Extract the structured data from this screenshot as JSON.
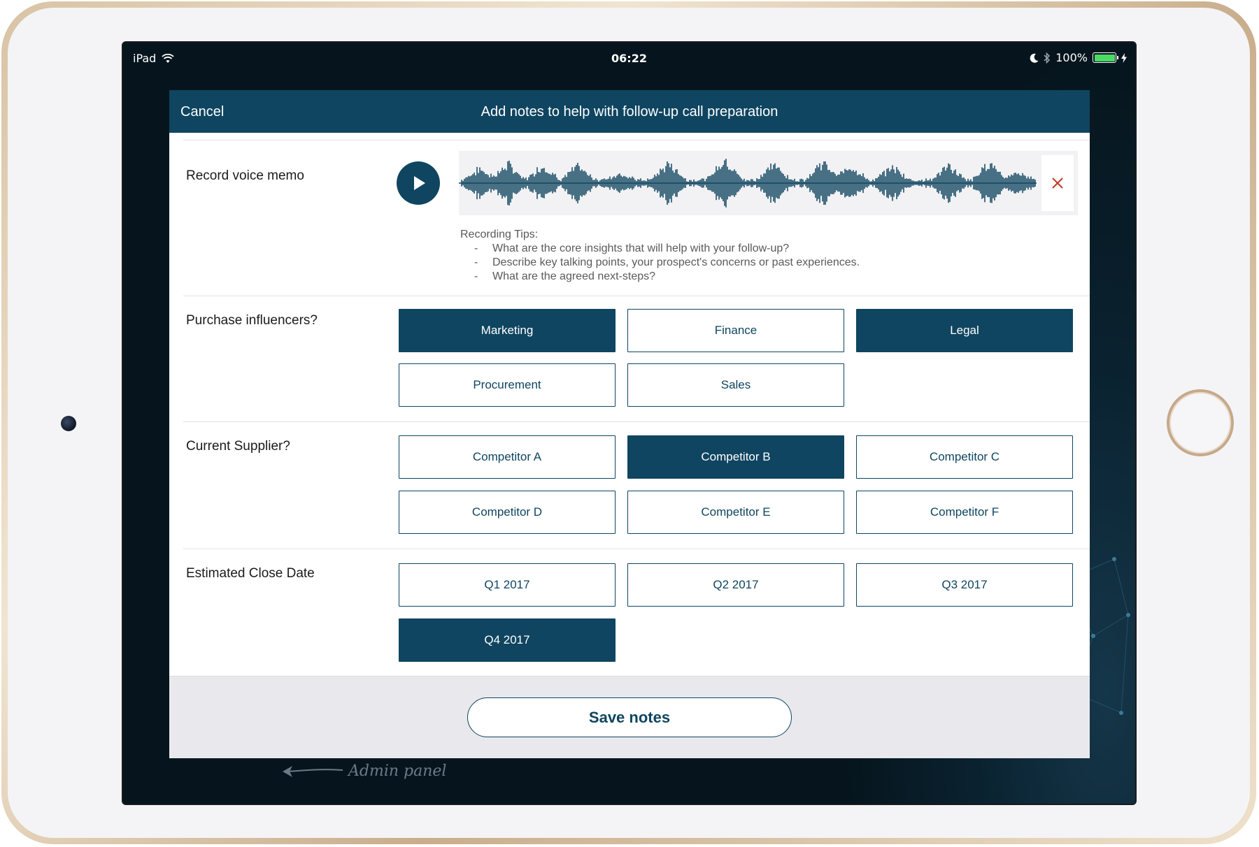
{
  "status_bar": {
    "device": "iPad",
    "time": "06:22",
    "battery": "100%",
    "battery_level": 1.0
  },
  "header": {
    "cancel_label": "Cancel",
    "title": "Add notes to help with follow-up call preparation"
  },
  "voice_memo": {
    "label": "Record voice memo",
    "tips_title": "Recording Tips:",
    "tips": [
      "What are the core insights that will help with your follow-up?",
      "Describe key talking points, your prospect's concerns or past experiences.",
      "What are the agreed next-steps?"
    ],
    "tip_bullet": "-"
  },
  "influencers": {
    "label": "Purchase influencers?",
    "options": [
      {
        "label": "Marketing",
        "selected": true
      },
      {
        "label": "Finance",
        "selected": false
      },
      {
        "label": "Legal",
        "selected": true
      },
      {
        "label": "Procurement",
        "selected": false
      },
      {
        "label": "Sales",
        "selected": false
      }
    ]
  },
  "supplier": {
    "label": "Current Supplier?",
    "options": [
      {
        "label": "Competitor A",
        "selected": false
      },
      {
        "label": "Competitor B",
        "selected": true
      },
      {
        "label": "Competitor C",
        "selected": false
      },
      {
        "label": "Competitor D",
        "selected": false
      },
      {
        "label": "Competitor E",
        "selected": false
      },
      {
        "label": "Competitor F",
        "selected": false
      }
    ]
  },
  "close_date": {
    "label": "Estimated Close Date",
    "options": [
      {
        "label": "Q1 2017",
        "selected": false
      },
      {
        "label": "Q2 2017",
        "selected": false
      },
      {
        "label": "Q3 2017",
        "selected": false
      },
      {
        "label": "Q4 2017",
        "selected": true
      }
    ]
  },
  "footer": {
    "save_label": "Save notes"
  },
  "admin_link": "Admin panel",
  "colors": {
    "accent": "#0f4560",
    "screen_bg": "#06151d",
    "footer_bg": "#e9e9ed",
    "close_icon": "#c0392b",
    "battery": "#4cd964"
  }
}
